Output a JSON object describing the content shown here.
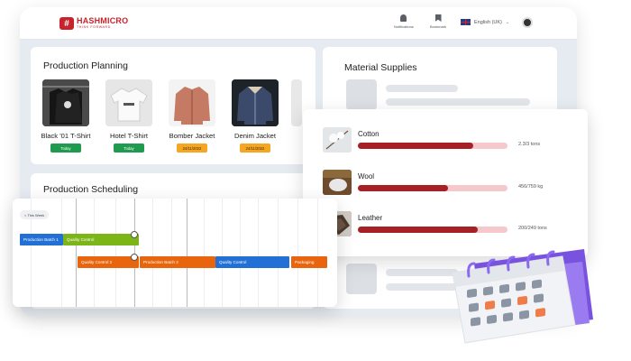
{
  "brand": {
    "name": "HASHMICRO",
    "tagline": "THINK FORWARD"
  },
  "nav": {
    "notifications_label": "Notifications",
    "bookmark_label": "Bookmark",
    "language_label": "English (UK)"
  },
  "colors": {
    "brand_red": "#c8232c",
    "progress_fill": "#a52126",
    "badge_green": "#1f9b4f",
    "badge_amber": "#f5a623"
  },
  "production_planning": {
    "title": "Production Planning",
    "items": [
      {
        "name": "Black '01 T-Shirt",
        "badge": "Today"
      },
      {
        "name": "Hotel T-Shirt",
        "badge": "Today"
      },
      {
        "name": "Bomber Jacket",
        "badge": "24/11/2022"
      },
      {
        "name": "Denim Jacket",
        "badge": "24/11/2022"
      }
    ]
  },
  "production_scheduling": {
    "title": "Production Scheduling",
    "week_label": "< This Week",
    "tasks": [
      {
        "label": "Production Batch 1",
        "color": "blue"
      },
      {
        "label": "Quality Control",
        "color": "green"
      },
      {
        "label": "Quality Control 2",
        "color": "orange"
      },
      {
        "label": "Production Batch 2",
        "color": "orange"
      },
      {
        "label": "Quality Control",
        "color": "blue"
      },
      {
        "label": "Packaging",
        "color": "orange"
      }
    ]
  },
  "material_supplies": {
    "title": "Material Supplies",
    "items": [
      {
        "name": "Cotton",
        "value": "2.3/3 tons",
        "fill": 0.77
      },
      {
        "name": "Wool",
        "value": "456/759 kg",
        "fill": 0.6
      },
      {
        "name": "Leather",
        "value": "200/249 tons",
        "fill": 0.8
      }
    ]
  }
}
